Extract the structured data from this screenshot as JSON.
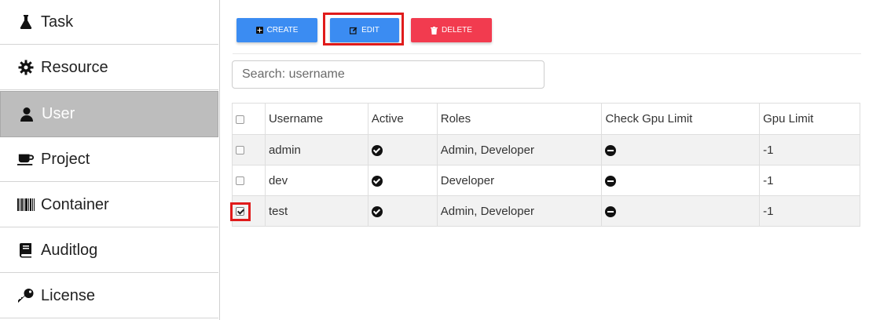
{
  "sidebar": {
    "items": [
      {
        "label": "Task",
        "icon": "flask-icon"
      },
      {
        "label": "Resource",
        "icon": "gear-icon"
      },
      {
        "label": "User",
        "icon": "user-icon",
        "active": true
      },
      {
        "label": "Project",
        "icon": "coffee-icon"
      },
      {
        "label": "Container",
        "icon": "barcode-icon"
      },
      {
        "label": "Auditlog",
        "icon": "book-icon"
      },
      {
        "label": "License",
        "icon": "key-icon"
      }
    ]
  },
  "toolbar": {
    "create_label": "CREATE",
    "edit_label": "EDIT",
    "delete_label": "DELETE"
  },
  "search": {
    "placeholder": "Search: username",
    "value": ""
  },
  "table": {
    "headers": [
      "Username",
      "Active",
      "Roles",
      "Check Gpu Limit",
      "Gpu Limit"
    ],
    "rows": [
      {
        "checked": false,
        "username": "admin",
        "active": true,
        "roles": "Admin, Developer",
        "check_gpu_limit": false,
        "gpu_limit": "-1"
      },
      {
        "checked": false,
        "username": "dev",
        "active": true,
        "roles": "Developer",
        "check_gpu_limit": false,
        "gpu_limit": "-1"
      },
      {
        "checked": true,
        "username": "test",
        "active": true,
        "roles": "Admin, Developer",
        "check_gpu_limit": false,
        "gpu_limit": "-1"
      }
    ]
  },
  "colors": {
    "primary": "#3b8cf2",
    "danger": "#f23b4f",
    "active_nav": "#bdbdbd",
    "highlight": "#e01b1b"
  }
}
